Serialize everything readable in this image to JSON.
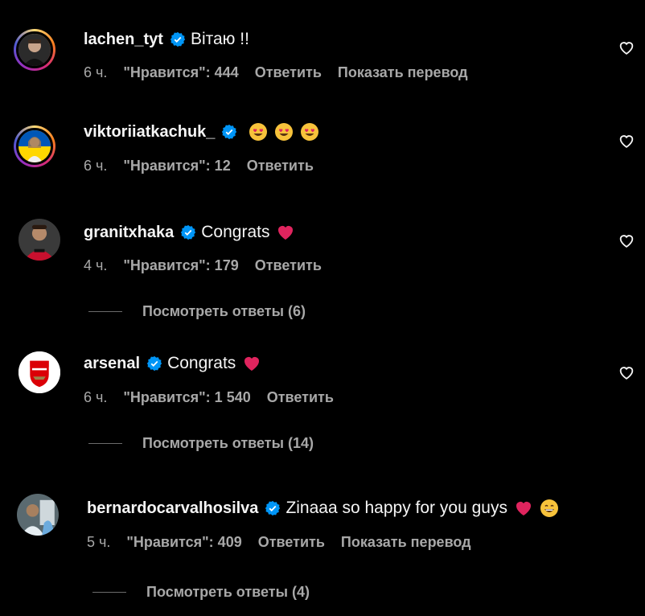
{
  "comments": [
    {
      "username": "lachen_tyt",
      "text": "Вітаю !!",
      "time": "6 ч.",
      "likes": "\"Нравится\": 444",
      "reply": "Ответить",
      "translate": "Показать перевод"
    },
    {
      "username": "viktoriiatkachuk_",
      "text": "",
      "time": "6 ч.",
      "likes": "\"Нравится\": 12",
      "reply": "Ответить"
    },
    {
      "username": "granitxhaka",
      "text": "Congrats",
      "time": "4 ч.",
      "likes": "\"Нравится\": 179",
      "reply": "Ответить",
      "view_replies": "Посмотреть ответы (6)"
    },
    {
      "username": "arsenal",
      "text": "Congrats",
      "time": "6 ч.",
      "likes": "\"Нравится\": 1 540",
      "reply": "Ответить",
      "view_replies": "Посмотреть ответы (14)"
    },
    {
      "username": "bernardocarvalhosilva",
      "text": "Zinaaa so happy for you guys",
      "time": "5 ч.",
      "likes": "\"Нравится\": 409",
      "reply": "Ответить",
      "translate": "Показать перевод",
      "view_replies": "Посмотреть ответы (4)"
    }
  ],
  "colors": {
    "verified": "#0095f6",
    "heart_emoji": "#e0245e",
    "secondary_text": "#a8a8a8"
  }
}
